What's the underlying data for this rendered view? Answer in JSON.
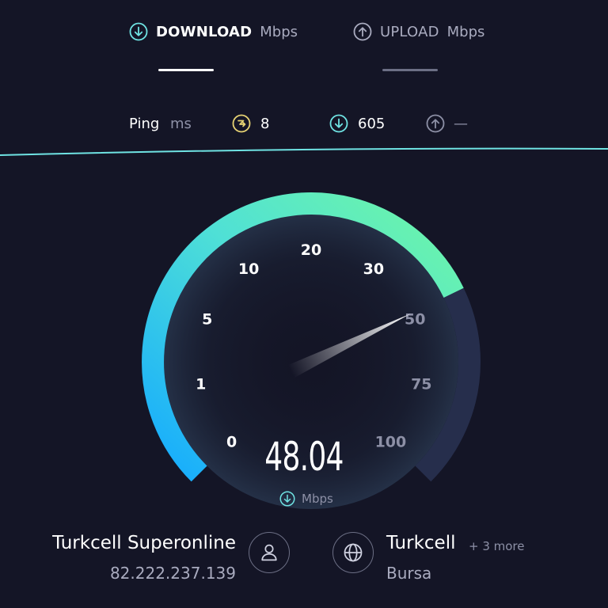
{
  "tabs": {
    "download": {
      "label": "DOWNLOAD",
      "unit": "Mbps"
    },
    "upload": {
      "label": "UPLOAD",
      "unit": "Mbps"
    }
  },
  "ping": {
    "label": "Ping",
    "unit": "ms",
    "idle_value": "8",
    "download_value": "605",
    "upload_value": "—"
  },
  "gauge": {
    "value": "48.04",
    "value_number": 48.04,
    "unit": "Mbps",
    "scale": [
      "0",
      "1",
      "5",
      "10",
      "20",
      "30",
      "50",
      "75",
      "100"
    ]
  },
  "isp": {
    "name": "Turkcell Superonline",
    "ip": "82.222.237.139"
  },
  "server": {
    "name": "Turkcell",
    "more": "+ 3 more",
    "location": "Bursa"
  },
  "colors": {
    "background": "#141526",
    "accent_cyan": "#6fe3e3",
    "gauge_start": "#14aaff",
    "gauge_end": "#6ff7a5",
    "gauge_track": "#262e4c",
    "ping_idle_color": "#e6d273"
  },
  "icons": {
    "download": "arrow-down-circle-icon",
    "upload": "arrow-up-circle-icon",
    "idle_ping": "lightning-circle-icon",
    "user": "user-icon",
    "server": "globe-icon"
  }
}
